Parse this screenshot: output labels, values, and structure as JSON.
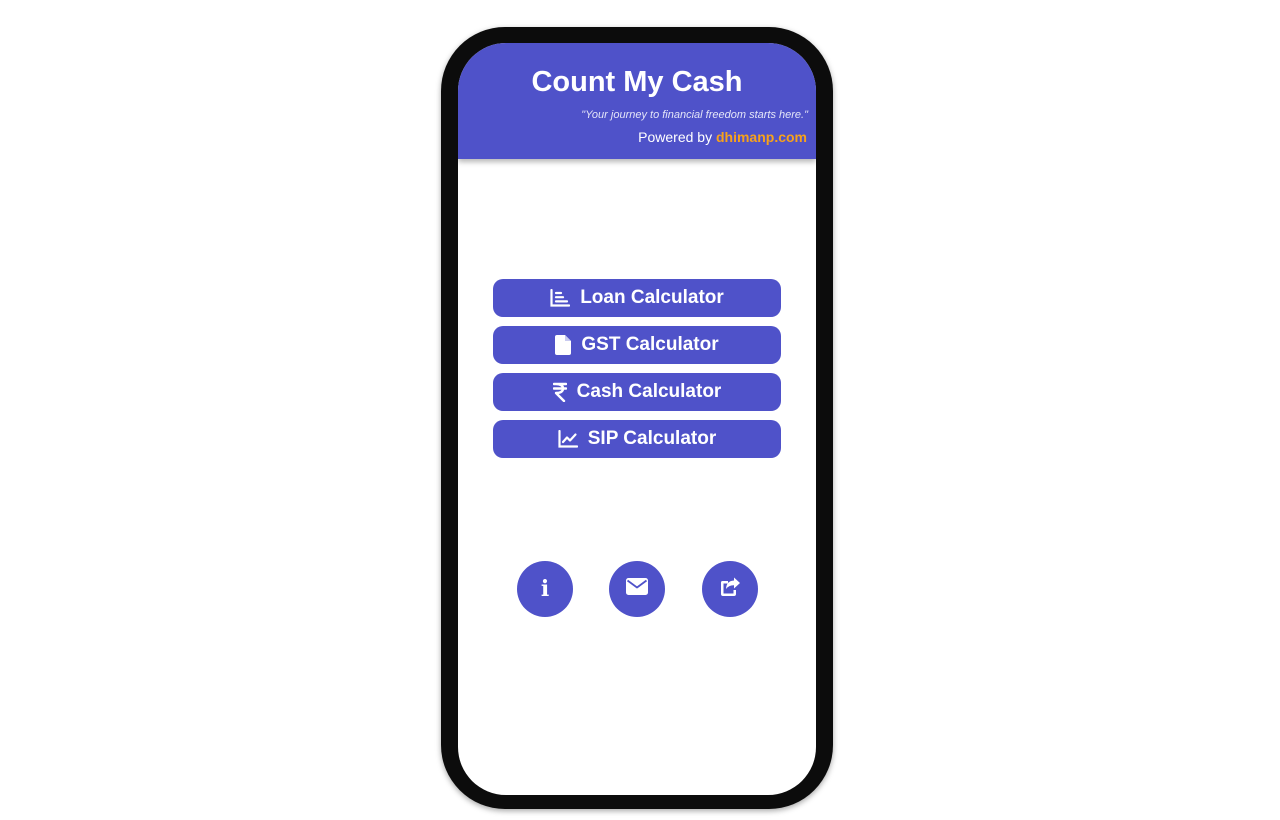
{
  "app": {
    "title": "Count My Cash",
    "tagline": "\"Your journey to financial freedom starts here.\"",
    "powered_prefix": "Powered by",
    "powered_site": "dhimanp.com"
  },
  "menu": [
    {
      "label": "Loan Calculator",
      "icon": "list-chart-icon"
    },
    {
      "label": "GST Calculator",
      "icon": "file-icon"
    },
    {
      "label": "Cash Calculator",
      "icon": "rupee-icon"
    },
    {
      "label": "SIP Calculator",
      "icon": "line-chart-icon"
    }
  ],
  "actions": [
    {
      "name": "info",
      "icon": "info-icon",
      "glyph": "i"
    },
    {
      "name": "email",
      "icon": "envelope-icon"
    },
    {
      "name": "share",
      "icon": "share-icon"
    }
  ],
  "colors": {
    "primary": "#4f52c9",
    "accent": "#f7a21b",
    "frame": "#0c0c0c",
    "background": "#ffffff"
  }
}
